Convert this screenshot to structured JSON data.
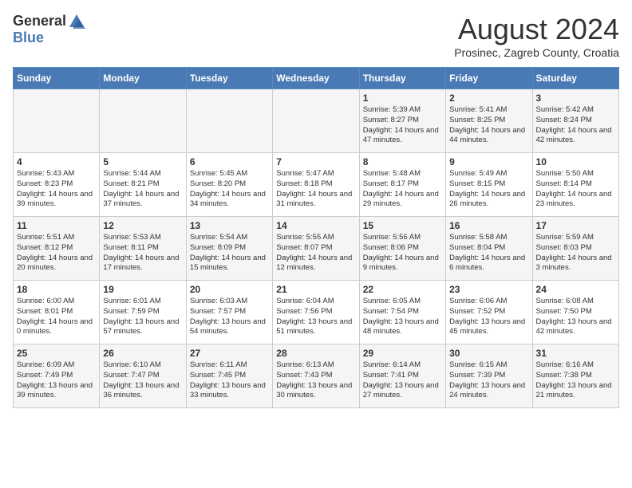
{
  "header": {
    "logo_general": "General",
    "logo_blue": "Blue",
    "month_title": "August 2024",
    "subtitle": "Prosinec, Zagreb County, Croatia"
  },
  "days_of_week": [
    "Sunday",
    "Monday",
    "Tuesday",
    "Wednesday",
    "Thursday",
    "Friday",
    "Saturday"
  ],
  "weeks": [
    [
      {
        "day": "",
        "content": ""
      },
      {
        "day": "",
        "content": ""
      },
      {
        "day": "",
        "content": ""
      },
      {
        "day": "",
        "content": ""
      },
      {
        "day": "1",
        "content": "Sunrise: 5:39 AM\nSunset: 8:27 PM\nDaylight: 14 hours and 47 minutes."
      },
      {
        "day": "2",
        "content": "Sunrise: 5:41 AM\nSunset: 8:25 PM\nDaylight: 14 hours and 44 minutes."
      },
      {
        "day": "3",
        "content": "Sunrise: 5:42 AM\nSunset: 8:24 PM\nDaylight: 14 hours and 42 minutes."
      }
    ],
    [
      {
        "day": "4",
        "content": "Sunrise: 5:43 AM\nSunset: 8:23 PM\nDaylight: 14 hours and 39 minutes."
      },
      {
        "day": "5",
        "content": "Sunrise: 5:44 AM\nSunset: 8:21 PM\nDaylight: 14 hours and 37 minutes."
      },
      {
        "day": "6",
        "content": "Sunrise: 5:45 AM\nSunset: 8:20 PM\nDaylight: 14 hours and 34 minutes."
      },
      {
        "day": "7",
        "content": "Sunrise: 5:47 AM\nSunset: 8:18 PM\nDaylight: 14 hours and 31 minutes."
      },
      {
        "day": "8",
        "content": "Sunrise: 5:48 AM\nSunset: 8:17 PM\nDaylight: 14 hours and 29 minutes."
      },
      {
        "day": "9",
        "content": "Sunrise: 5:49 AM\nSunset: 8:15 PM\nDaylight: 14 hours and 26 minutes."
      },
      {
        "day": "10",
        "content": "Sunrise: 5:50 AM\nSunset: 8:14 PM\nDaylight: 14 hours and 23 minutes."
      }
    ],
    [
      {
        "day": "11",
        "content": "Sunrise: 5:51 AM\nSunset: 8:12 PM\nDaylight: 14 hours and 20 minutes."
      },
      {
        "day": "12",
        "content": "Sunrise: 5:53 AM\nSunset: 8:11 PM\nDaylight: 14 hours and 17 minutes."
      },
      {
        "day": "13",
        "content": "Sunrise: 5:54 AM\nSunset: 8:09 PM\nDaylight: 14 hours and 15 minutes."
      },
      {
        "day": "14",
        "content": "Sunrise: 5:55 AM\nSunset: 8:07 PM\nDaylight: 14 hours and 12 minutes."
      },
      {
        "day": "15",
        "content": "Sunrise: 5:56 AM\nSunset: 8:06 PM\nDaylight: 14 hours and 9 minutes."
      },
      {
        "day": "16",
        "content": "Sunrise: 5:58 AM\nSunset: 8:04 PM\nDaylight: 14 hours and 6 minutes."
      },
      {
        "day": "17",
        "content": "Sunrise: 5:59 AM\nSunset: 8:03 PM\nDaylight: 14 hours and 3 minutes."
      }
    ],
    [
      {
        "day": "18",
        "content": "Sunrise: 6:00 AM\nSunset: 8:01 PM\nDaylight: 14 hours and 0 minutes."
      },
      {
        "day": "19",
        "content": "Sunrise: 6:01 AM\nSunset: 7:59 PM\nDaylight: 13 hours and 57 minutes."
      },
      {
        "day": "20",
        "content": "Sunrise: 6:03 AM\nSunset: 7:57 PM\nDaylight: 13 hours and 54 minutes."
      },
      {
        "day": "21",
        "content": "Sunrise: 6:04 AM\nSunset: 7:56 PM\nDaylight: 13 hours and 51 minutes."
      },
      {
        "day": "22",
        "content": "Sunrise: 6:05 AM\nSunset: 7:54 PM\nDaylight: 13 hours and 48 minutes."
      },
      {
        "day": "23",
        "content": "Sunrise: 6:06 AM\nSunset: 7:52 PM\nDaylight: 13 hours and 45 minutes."
      },
      {
        "day": "24",
        "content": "Sunrise: 6:08 AM\nSunset: 7:50 PM\nDaylight: 13 hours and 42 minutes."
      }
    ],
    [
      {
        "day": "25",
        "content": "Sunrise: 6:09 AM\nSunset: 7:49 PM\nDaylight: 13 hours and 39 minutes."
      },
      {
        "day": "26",
        "content": "Sunrise: 6:10 AM\nSunset: 7:47 PM\nDaylight: 13 hours and 36 minutes."
      },
      {
        "day": "27",
        "content": "Sunrise: 6:11 AM\nSunset: 7:45 PM\nDaylight: 13 hours and 33 minutes."
      },
      {
        "day": "28",
        "content": "Sunrise: 6:13 AM\nSunset: 7:43 PM\nDaylight: 13 hours and 30 minutes."
      },
      {
        "day": "29",
        "content": "Sunrise: 6:14 AM\nSunset: 7:41 PM\nDaylight: 13 hours and 27 minutes."
      },
      {
        "day": "30",
        "content": "Sunrise: 6:15 AM\nSunset: 7:39 PM\nDaylight: 13 hours and 24 minutes."
      },
      {
        "day": "31",
        "content": "Sunrise: 6:16 AM\nSunset: 7:38 PM\nDaylight: 13 hours and 21 minutes."
      }
    ]
  ]
}
